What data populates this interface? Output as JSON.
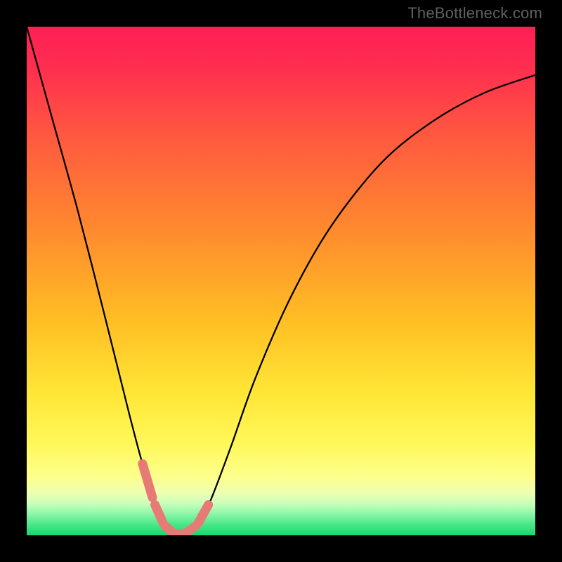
{
  "attribution": "TheBottleneck.com",
  "colors": {
    "black": "#000000",
    "curve": "#000000",
    "marker": "#e77a74",
    "gradient_stops": [
      {
        "pos": 0.0,
        "color": "#ff1f55"
      },
      {
        "pos": 0.08,
        "color": "#ff2e50"
      },
      {
        "pos": 0.22,
        "color": "#ff5a3f"
      },
      {
        "pos": 0.4,
        "color": "#ff8a2e"
      },
      {
        "pos": 0.58,
        "color": "#ffbf24"
      },
      {
        "pos": 0.72,
        "color": "#ffe636"
      },
      {
        "pos": 0.82,
        "color": "#fff85a"
      },
      {
        "pos": 0.885,
        "color": "#fdff8c"
      },
      {
        "pos": 0.915,
        "color": "#f0ffb0"
      },
      {
        "pos": 0.938,
        "color": "#c8ffba"
      },
      {
        "pos": 0.958,
        "color": "#8cf6a8"
      },
      {
        "pos": 0.978,
        "color": "#4be88a"
      },
      {
        "pos": 1.0,
        "color": "#18d66e"
      }
    ]
  },
  "chart_data": {
    "type": "line",
    "title": "",
    "xlabel": "",
    "ylabel": "",
    "xlim": [
      0,
      1
    ],
    "ylim": [
      0,
      1
    ],
    "note": "Axes unlabeled in source image; x and y are normalized to the plotting rectangle. Curve is a V-shaped bottleneck profile dipping to ~0 near x≈0.30 and rising on both sides.",
    "series": [
      {
        "name": "bottleneck-curve",
        "x": [
          0.0,
          0.05,
          0.1,
          0.15,
          0.2,
          0.225,
          0.25,
          0.27,
          0.29,
          0.31,
          0.335,
          0.36,
          0.4,
          0.45,
          0.52,
          0.6,
          0.7,
          0.8,
          0.9,
          1.0
        ],
        "y": [
          1.0,
          0.82,
          0.64,
          0.445,
          0.245,
          0.15,
          0.065,
          0.02,
          0.003,
          0.003,
          0.02,
          0.065,
          0.17,
          0.31,
          0.47,
          0.61,
          0.735,
          0.815,
          0.87,
          0.905
        ]
      }
    ],
    "markers": {
      "name": "highlighted-region",
      "color": "#e77a74",
      "x": [
        0.225,
        0.25,
        0.27,
        0.29,
        0.31,
        0.335,
        0.36
      ],
      "y": [
        0.15,
        0.065,
        0.02,
        0.003,
        0.003,
        0.02,
        0.065
      ]
    }
  }
}
